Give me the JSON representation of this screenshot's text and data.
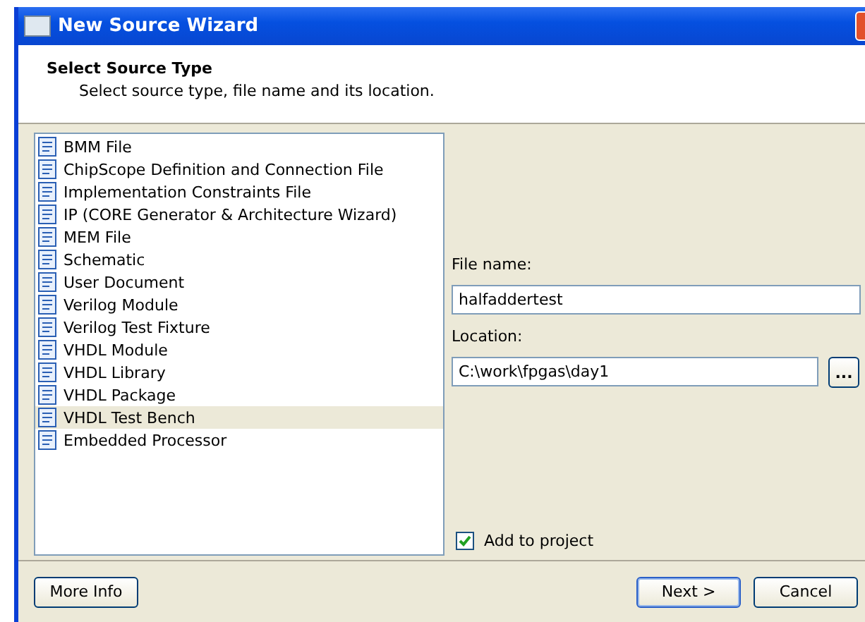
{
  "window": {
    "title": "New Source Wizard"
  },
  "header": {
    "title": "Select Source Type",
    "subtitle": "Select source type, file name and its location."
  },
  "source_types": [
    {
      "label": "BMM File",
      "selected": false
    },
    {
      "label": "ChipScope Definition and Connection File",
      "selected": false
    },
    {
      "label": "Implementation Constraints File",
      "selected": false
    },
    {
      "label": "IP (CORE Generator & Architecture Wizard)",
      "selected": false
    },
    {
      "label": "MEM File",
      "selected": false
    },
    {
      "label": "Schematic",
      "selected": false
    },
    {
      "label": "User Document",
      "selected": false
    },
    {
      "label": "Verilog Module",
      "selected": false
    },
    {
      "label": "Verilog Test Fixture",
      "selected": false
    },
    {
      "label": "VHDL Module",
      "selected": false
    },
    {
      "label": "VHDL Library",
      "selected": false
    },
    {
      "label": "VHDL Package",
      "selected": false
    },
    {
      "label": "VHDL Test Bench",
      "selected": true
    },
    {
      "label": "Embedded Processor",
      "selected": false
    }
  ],
  "file_name": {
    "label": "File name:",
    "value": "halfaddertest"
  },
  "location": {
    "label": "Location:",
    "value": "C:\\work\\fpgas\\day1",
    "browse": "..."
  },
  "add_to_project": {
    "label": "Add to project",
    "checked": true
  },
  "buttons": {
    "more_info": "More Info",
    "next": "Next >",
    "cancel": "Cancel"
  }
}
